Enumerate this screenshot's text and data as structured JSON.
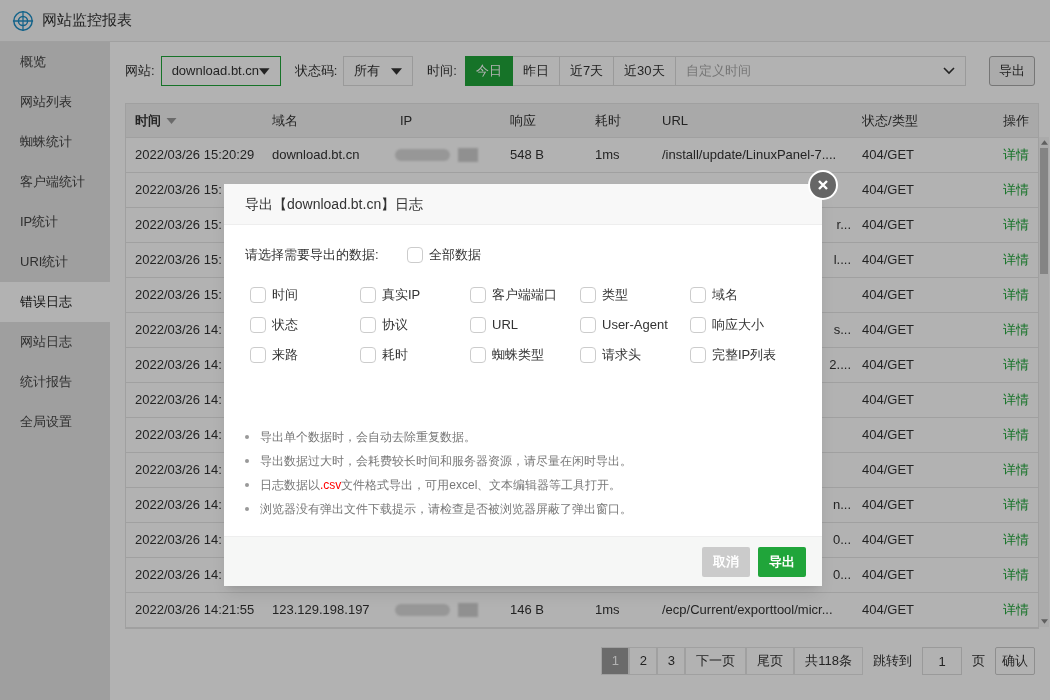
{
  "app": {
    "title": "网站监控报表"
  },
  "sidebar": {
    "items": [
      {
        "label": "概览",
        "selected": false
      },
      {
        "label": "网站列表",
        "selected": false
      },
      {
        "label": "蜘蛛统计",
        "selected": false
      },
      {
        "label": "客户端统计",
        "selected": false
      },
      {
        "label": "IP统计",
        "selected": false
      },
      {
        "label": "URI统计",
        "selected": false
      },
      {
        "label": "错误日志",
        "selected": true
      },
      {
        "label": "网站日志",
        "selected": false
      },
      {
        "label": "统计报告",
        "selected": false
      },
      {
        "label": "全局设置",
        "selected": false
      }
    ]
  },
  "filters": {
    "site_label": "网站:",
    "site_value": "download.bt.cn",
    "status_label": "状态码:",
    "status_value": "所有",
    "time_label": "时间:",
    "time_ranges": [
      {
        "label": "今日",
        "selected": true
      },
      {
        "label": "昨日",
        "selected": false
      },
      {
        "label": "近7天",
        "selected": false
      },
      {
        "label": "近30天",
        "selected": false
      }
    ],
    "custom_time_placeholder": "自定义时间",
    "export_button": "导出"
  },
  "table": {
    "columns": [
      {
        "label": "时间",
        "sorted": true
      },
      {
        "label": "域名",
        "sorted": false
      },
      {
        "label": "IP",
        "sorted": false
      },
      {
        "label": "响应",
        "sorted": false
      },
      {
        "label": "耗时",
        "sorted": false
      },
      {
        "label": "URL",
        "sorted": false
      },
      {
        "label": "状态/类型",
        "sorted": false
      },
      {
        "label": "操作",
        "sorted": false
      }
    ],
    "rows": [
      {
        "kind": "full",
        "time": "2022/03/26 15:20:29",
        "domain": "download.bt.cn",
        "size": "548 B",
        "duration": "1ms",
        "url": "/install/update/LinuxPanel-7....",
        "status": "404/GET",
        "action": "详情"
      },
      {
        "kind": "covered",
        "time": "2022/03/26 15:",
        "status": "404/GET",
        "action": "详情"
      },
      {
        "kind": "covered",
        "time": "2022/03/26 15:",
        "url": "r...",
        "status": "404/GET",
        "action": "详情"
      },
      {
        "kind": "covered",
        "time": "2022/03/26 15:",
        "url": "l....",
        "status": "404/GET",
        "action": "详情"
      },
      {
        "kind": "covered",
        "time": "2022/03/26 15:",
        "status": "404/GET",
        "action": "详情"
      },
      {
        "kind": "covered",
        "time": "2022/03/26 14:",
        "url": "s...",
        "status": "404/GET",
        "action": "详情"
      },
      {
        "kind": "covered",
        "time": "2022/03/26 14:",
        "url": "2....",
        "status": "404/GET",
        "action": "详情"
      },
      {
        "kind": "covered",
        "time": "2022/03/26 14:",
        "status": "404/GET",
        "action": "详情"
      },
      {
        "kind": "covered",
        "time": "2022/03/26 14:",
        "status": "404/GET",
        "action": "详情"
      },
      {
        "kind": "covered",
        "time": "2022/03/26 14:",
        "status": "404/GET",
        "action": "详情"
      },
      {
        "kind": "covered",
        "time": "2022/03/26 14:",
        "url": "n...",
        "status": "404/GET",
        "action": "详情"
      },
      {
        "kind": "covered",
        "time": "2022/03/26 14:",
        "url": "0...",
        "status": "404/GET",
        "action": "详情"
      },
      {
        "kind": "covered",
        "time": "2022/03/26 14:",
        "url": "0...",
        "status": "404/GET",
        "action": "详情"
      },
      {
        "kind": "full",
        "time": "2022/03/26 14:21:55",
        "domain": "123.129.198.197",
        "size": "146 B",
        "duration": "1ms",
        "url": "/ecp/Current/exporttool/micr...",
        "status": "404/GET",
        "action": "详情"
      }
    ]
  },
  "pagination": {
    "pages": [
      {
        "label": "1",
        "selected": true
      },
      {
        "label": "2",
        "selected": false
      },
      {
        "label": "3",
        "selected": false
      }
    ],
    "next": "下一页",
    "last": "尾页",
    "total": "共118条",
    "jump_label": "跳转到",
    "jump_value": "1",
    "page_unit": "页",
    "confirm": "确认"
  },
  "modal": {
    "title": "导出【download.bt.cn】日志",
    "prompt": "请选择需要导出的数据:",
    "all_option": {
      "label": "全部数据",
      "checked": false
    },
    "options": [
      {
        "label": "时间",
        "checked": false
      },
      {
        "label": "真实IP",
        "checked": false
      },
      {
        "label": "客户端端口",
        "checked": false
      },
      {
        "label": "类型",
        "checked": false
      },
      {
        "label": "域名",
        "checked": false
      },
      {
        "label": "状态",
        "checked": false
      },
      {
        "label": "协议",
        "checked": false
      },
      {
        "label": "URL",
        "checked": false
      },
      {
        "label": "User-Agent",
        "checked": false
      },
      {
        "label": "响应大小",
        "checked": false
      },
      {
        "label": "来路",
        "checked": false
      },
      {
        "label": "耗时",
        "checked": false
      },
      {
        "label": "蜘蛛类型",
        "checked": false
      },
      {
        "label": "请求头",
        "checked": false
      },
      {
        "label": "完整IP列表",
        "checked": false
      }
    ],
    "notes": [
      [
        {
          "text": "导出单个数据时，会自动去除重复数据。",
          "highlight": false
        }
      ],
      [
        {
          "text": "导出数据过大时，会耗费较长时间和服务器资源，请尽量在闲时导出。",
          "highlight": false
        }
      ],
      [
        {
          "text": "日志数据以",
          "highlight": false
        },
        {
          "text": ".csv",
          "highlight": true
        },
        {
          "text": "文件格式导出，可用excel、文本编辑器等工具打开。",
          "highlight": false
        }
      ],
      [
        {
          "text": "浏览器没有弹出文件下载提示，请检查是否被浏览器屏蔽了弹出窗口。",
          "highlight": false
        }
      ]
    ],
    "buttons": [
      {
        "label": "取消",
        "kind": "secondary"
      },
      {
        "label": "导出",
        "kind": "primary"
      }
    ]
  }
}
